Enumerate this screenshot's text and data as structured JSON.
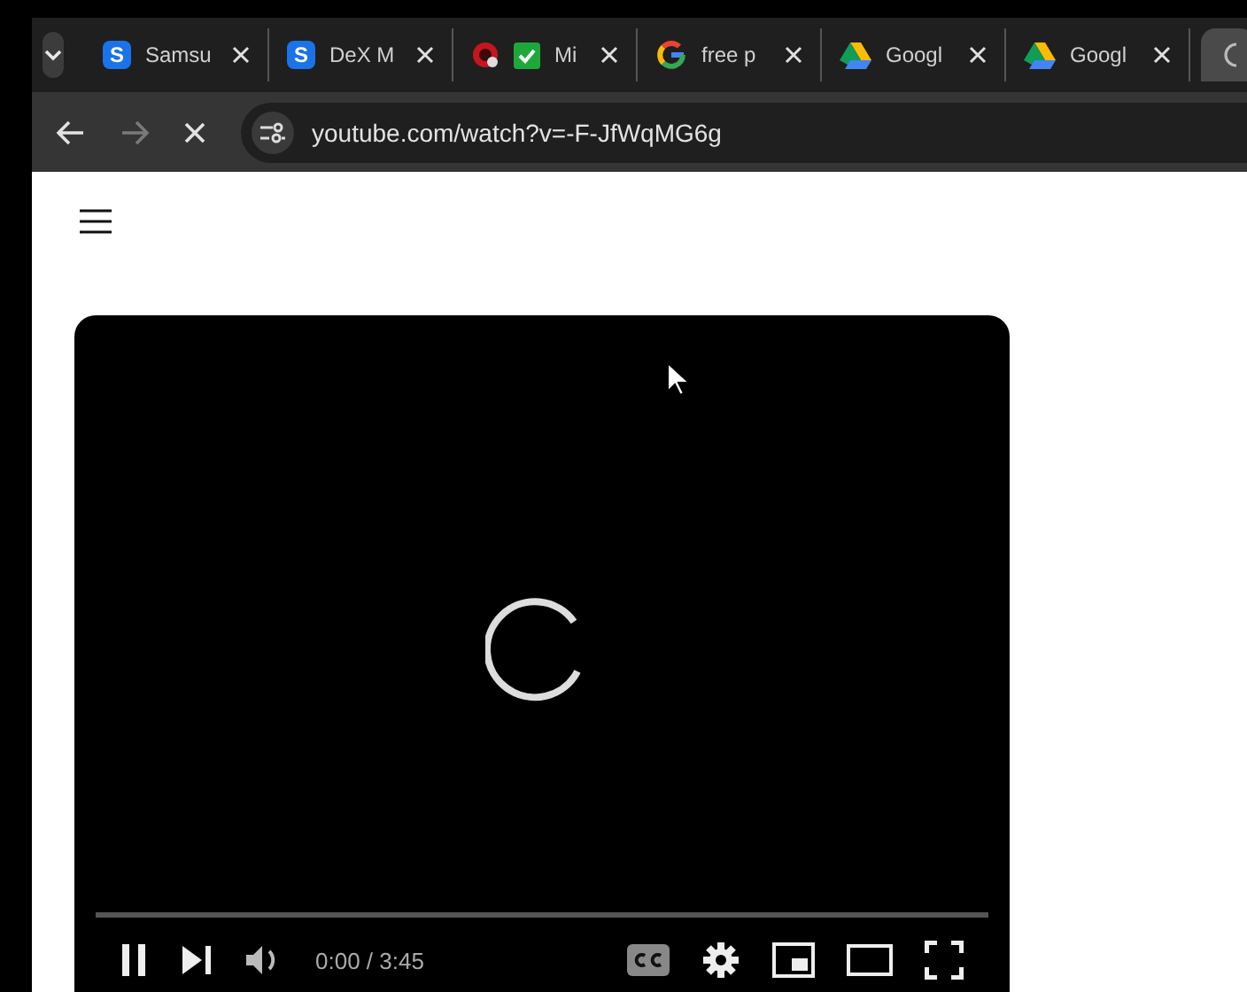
{
  "tabs": [
    {
      "kind": "badge",
      "badge": "S",
      "label": "Samsu",
      "selected": false
    },
    {
      "kind": "badge",
      "badge": "S",
      "label": "DeX M",
      "selected": false
    },
    {
      "kind": "record",
      "label": "Mi",
      "selected": false
    },
    {
      "kind": "google",
      "label": "free p",
      "selected": false
    },
    {
      "kind": "drive",
      "label": "Googl",
      "selected": false
    },
    {
      "kind": "drive",
      "label": "Googl",
      "selected": false
    },
    {
      "kind": "partial",
      "selected": true
    }
  ],
  "address": {
    "url": "youtube.com/watch?v=-F-JfWqMG6g",
    "loading": true
  },
  "player": {
    "time": "0:00 / 3:45",
    "playing": true,
    "progress": {
      "level": 0
    }
  }
}
